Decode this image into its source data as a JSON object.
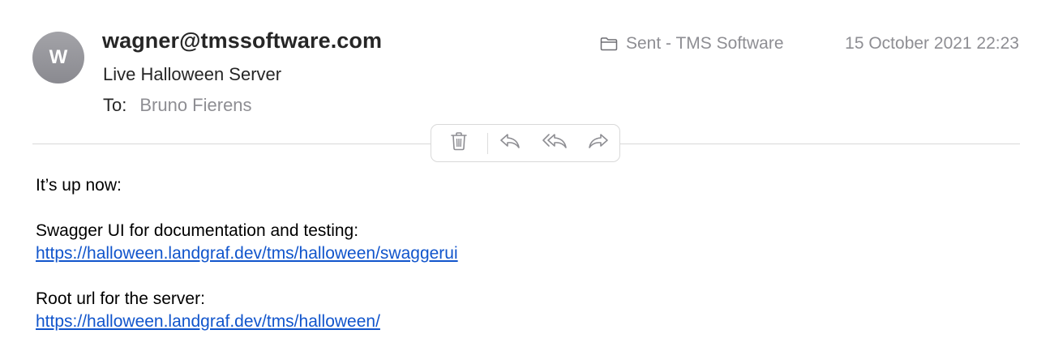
{
  "header": {
    "avatar_initial": "W",
    "sender": "wagner@tmssoftware.com",
    "subject": "Live Halloween Server",
    "to_label": "To:",
    "to_name": "Bruno Fierens",
    "mailbox": "Sent - TMS Software",
    "date": "15 October 2021 22:23"
  },
  "toolbar": {
    "icons": [
      "trash-icon",
      "reply-icon",
      "reply-all-icon",
      "forward-icon"
    ]
  },
  "message": {
    "line1": "It’s up now:",
    "swagger_label": "Swagger UI for documentation and testing:",
    "swagger_url": "https://halloween.landgraf.dev/tms/halloween/swaggerui",
    "root_label": "Root url for the server:",
    "root_url": "https://halloween.landgraf.dev/tms/halloween/"
  },
  "colors": {
    "link": "#1155cc",
    "muted": "#8e8e93",
    "avatar": "#9a9aa0"
  }
}
